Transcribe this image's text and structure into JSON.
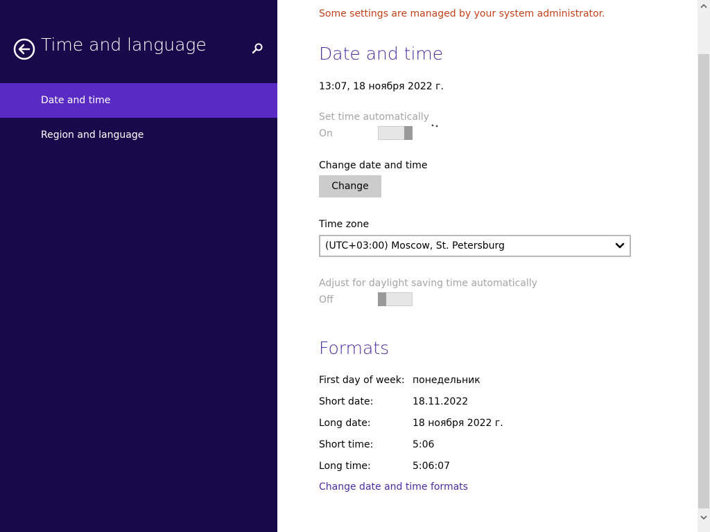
{
  "sidebar": {
    "title": "Time and language",
    "items": [
      {
        "label": "Date and time",
        "active": true
      },
      {
        "label": "Region and language",
        "active": false
      }
    ]
  },
  "content": {
    "admin_message": "Some settings are managed by your system administrator.",
    "date_time": {
      "heading": "Date and time",
      "current": "13:07, 18 ноября 2022 г.",
      "set_auto_label": "Set time automatically",
      "set_auto_state": "On",
      "change_label": "Change date and time",
      "change_button": "Change",
      "timezone_label": "Time zone",
      "timezone_value": "(UTC+03:00) Moscow, St. Petersburg",
      "dst_label": "Adjust for daylight saving time automatically",
      "dst_state": "Off"
    },
    "formats": {
      "heading": "Formats",
      "rows": [
        {
          "label": "First day of week:",
          "value": "понедельник"
        },
        {
          "label": "Short date:",
          "value": "18.11.2022"
        },
        {
          "label": "Long date:",
          "value": "18 ноября 2022 г."
        },
        {
          "label": "Short time:",
          "value": "5:06"
        },
        {
          "label": "Long time:",
          "value": "5:06:07"
        }
      ],
      "link": "Change date and time formats"
    }
  },
  "colors": {
    "sidebar_bg": "#180a4a",
    "active_item": "#5a2bc4",
    "accent": "#4a2ca0",
    "warning": "#c2411d"
  },
  "icons": [
    "back-arrow-icon",
    "search-icon",
    "chevron-down-icon",
    "loading-dots-icon"
  ]
}
